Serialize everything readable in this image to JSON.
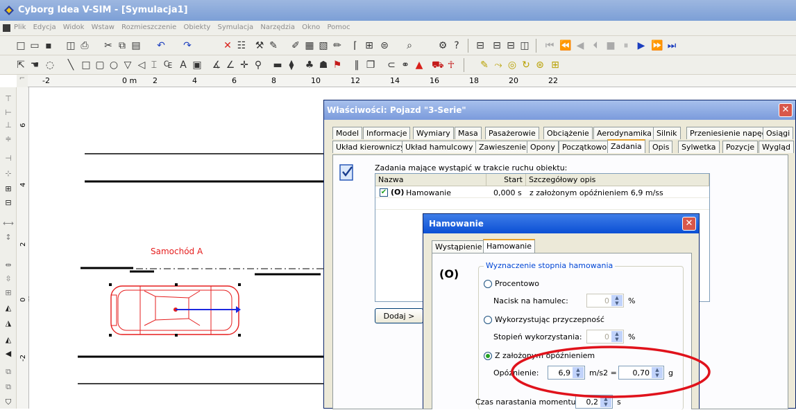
{
  "app": {
    "title": "Cyborg Idea V-SIM - [Symulacja1]"
  },
  "menu": [
    "Plik",
    "Edycja",
    "Widok",
    "Wstaw",
    "Rozmieszczenie",
    "Obiekty",
    "Symulacja",
    "Narzędzia",
    "Okno",
    "Pomoc"
  ],
  "ruler": {
    "labels": [
      "-2",
      "0 m",
      "2",
      "4",
      "6",
      "8",
      "10",
      "12",
      "14",
      "16",
      "18",
      "20",
      "22"
    ]
  },
  "vruler": {
    "labels": [
      "6",
      "4",
      "2",
      "0 m",
      "-2"
    ]
  },
  "canvas": {
    "car_label": "Samochód A"
  },
  "colors": {
    "car": "#e51d1d",
    "vector": "#1c28e0",
    "title_blue": "#7b9bdc",
    "highlight": "#e0121b"
  },
  "props": {
    "title": "Właściwości: Pojazd \"3-Serie\"",
    "tabs_row1": [
      "Model",
      "Informacje",
      "Wymiary",
      "Masa",
      "Pasażerowie",
      "Obciążenie",
      "Aerodynamika",
      "Silnik",
      "Przeniesienie napędu",
      "Osiągi"
    ],
    "tabs_row2": [
      "Układ kierowniczy",
      "Układ hamulcowy",
      "Zawieszenie",
      "Opony",
      "Początkowo",
      "Zadania",
      "Opis",
      "Sylwetka",
      "Pozycje",
      "Wygląd"
    ],
    "active_tab": "Zadania",
    "tasks_caption": "Zadania mające wystąpić w trakcie ruchu obiektu:",
    "columns": [
      "Nazwa",
      "Start",
      "Szczegółowy opis"
    ],
    "rows": [
      {
        "name": "Hamowanie",
        "start": "0,000 s",
        "desc": "z założonym opóźnieniem 6,9 m/ss",
        "checked": true
      }
    ],
    "add_button": "Dodaj >"
  },
  "braking": {
    "title": "Hamowanie",
    "tabs": [
      "Wystąpienie",
      "Hamowanie"
    ],
    "active_tab": "Hamowanie",
    "group_title": "Wyznaczenie stopnia hamowania",
    "opt1": "Procentowo",
    "opt1_label": "Nacisk na hamulec:",
    "opt1_value": "0",
    "opt1_unit": "%",
    "opt2": "Wykorzystując przyczepność",
    "opt2_label": "Stopień wykorzystania:",
    "opt2_value": "0",
    "opt2_unit": "%",
    "opt3": "Z założonym opóźnieniem",
    "opt3_selected": true,
    "decel_label": "Opóźnienie:",
    "decel_value": "6,9",
    "decel_unit": "m/s2 =",
    "g_value": "0,70",
    "g_unit": "g",
    "torque_label": "Czas narastania momentu:",
    "torque_value": "0,2",
    "torque_unit": "s"
  }
}
